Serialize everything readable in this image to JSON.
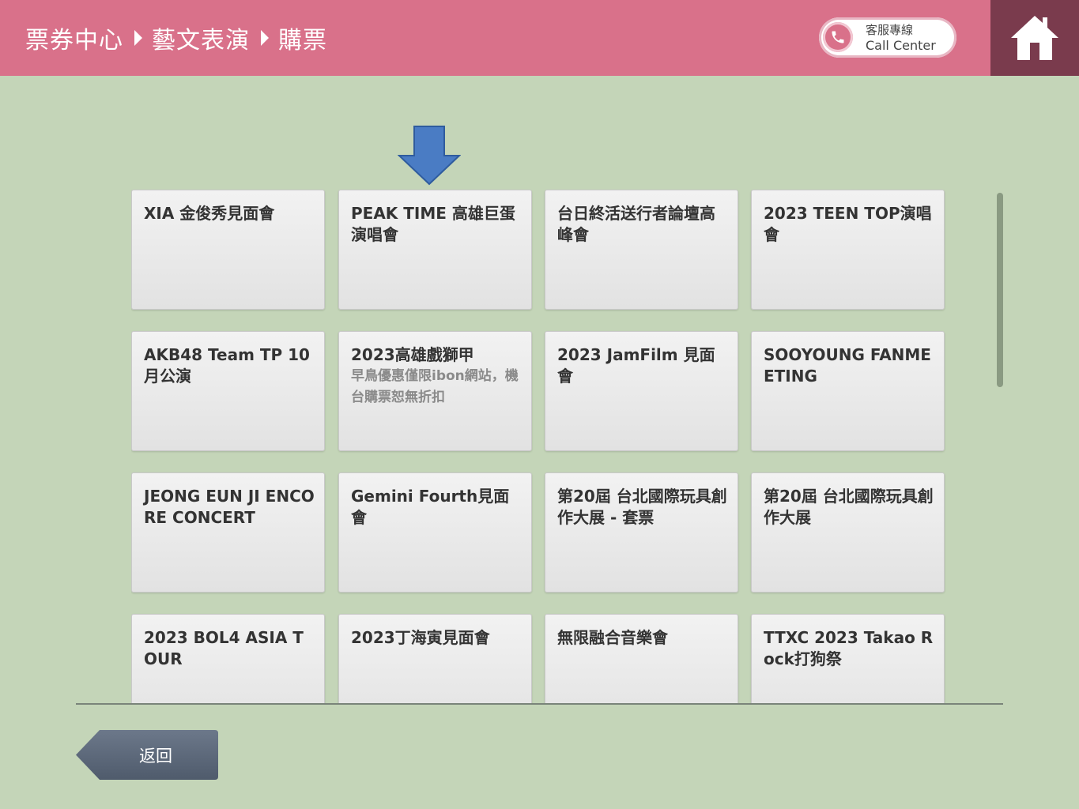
{
  "header": {
    "breadcrumb": [
      "票券中心",
      "藝文表演",
      "購票"
    ],
    "call_center": {
      "zh": "客服專線",
      "en": "Call Center"
    }
  },
  "icons": {
    "phone": "phone-icon",
    "home": "home-icon",
    "pointer": "down-arrow-icon"
  },
  "colors": {
    "header_bg": "#d9718a",
    "home_bg": "#7a3b4d",
    "page_bg": "#c4d5b8",
    "arrow": "#4a7cc4",
    "back_btn": "#5f6b7c"
  },
  "events": [
    {
      "title": "XIA 金俊秀見面會",
      "note": ""
    },
    {
      "title": "PEAK TIME 高雄巨蛋演唱會",
      "note": ""
    },
    {
      "title": "台日終活送行者論壇高峰會",
      "note": ""
    },
    {
      "title": "2023 TEEN TOP演唱會",
      "note": ""
    },
    {
      "title": "AKB48 Team TP 10月公演",
      "note": ""
    },
    {
      "title": "2023高雄戲獅甲",
      "note": "早鳥優惠僅限ibon網站，機台購票恕無折扣"
    },
    {
      "title": "2023 JamFilm 見面會",
      "note": ""
    },
    {
      "title": "SOOYOUNG FANMEETING",
      "note": ""
    },
    {
      "title": "JEONG EUN JI ENCORE CONCERT",
      "note": ""
    },
    {
      "title": "Gemini Fourth見面會",
      "note": ""
    },
    {
      "title": "第20屆 台北國際玩具創作大展 - 套票",
      "note": ""
    },
    {
      "title": "第20屆 台北國際玩具創作大展",
      "note": ""
    },
    {
      "title": "2023 BOL4 ASIA TOUR",
      "note": ""
    },
    {
      "title": "2023丁海寅見面會",
      "note": ""
    },
    {
      "title": "無限融合音樂會",
      "note": ""
    },
    {
      "title": "TTXC 2023 Takao Rock打狗祭",
      "note": ""
    }
  ],
  "footer": {
    "back_label": "返回"
  }
}
